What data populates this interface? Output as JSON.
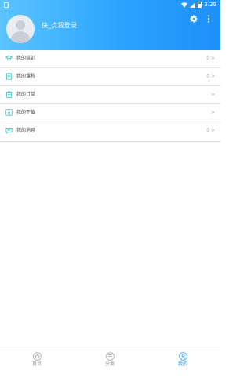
{
  "status_bar": {
    "time": "3:29"
  },
  "header": {
    "login_prompt": "快_点我登录",
    "settings_icon": "gear-icon",
    "more_icon": "more-vertical-icon",
    "gradient_colors": [
      "#5cc4ff",
      "#1e8ff8"
    ]
  },
  "menu": {
    "items": [
      {
        "label": "我的培训",
        "right": "0 >",
        "icon": "training-cap-icon"
      },
      {
        "label": "我的课程",
        "right": "0 >",
        "icon": "course-doc-icon"
      },
      {
        "label": "我的订单",
        "right": ">",
        "icon": "order-clipboard-icon"
      },
      {
        "label": "我的下载",
        "right": ">",
        "icon": "download-icon"
      },
      {
        "label": "我的消息",
        "right": "0 >",
        "icon": "message-icon"
      }
    ],
    "accent_color": "#34c3b5"
  },
  "tabbar": {
    "tabs": [
      {
        "label": "首页",
        "icon": "home-icon",
        "active": false
      },
      {
        "label": "分类",
        "icon": "category-icon",
        "active": false
      },
      {
        "label": "我的",
        "icon": "profile-icon",
        "active": true
      }
    ],
    "active_color": "#2196f3"
  }
}
